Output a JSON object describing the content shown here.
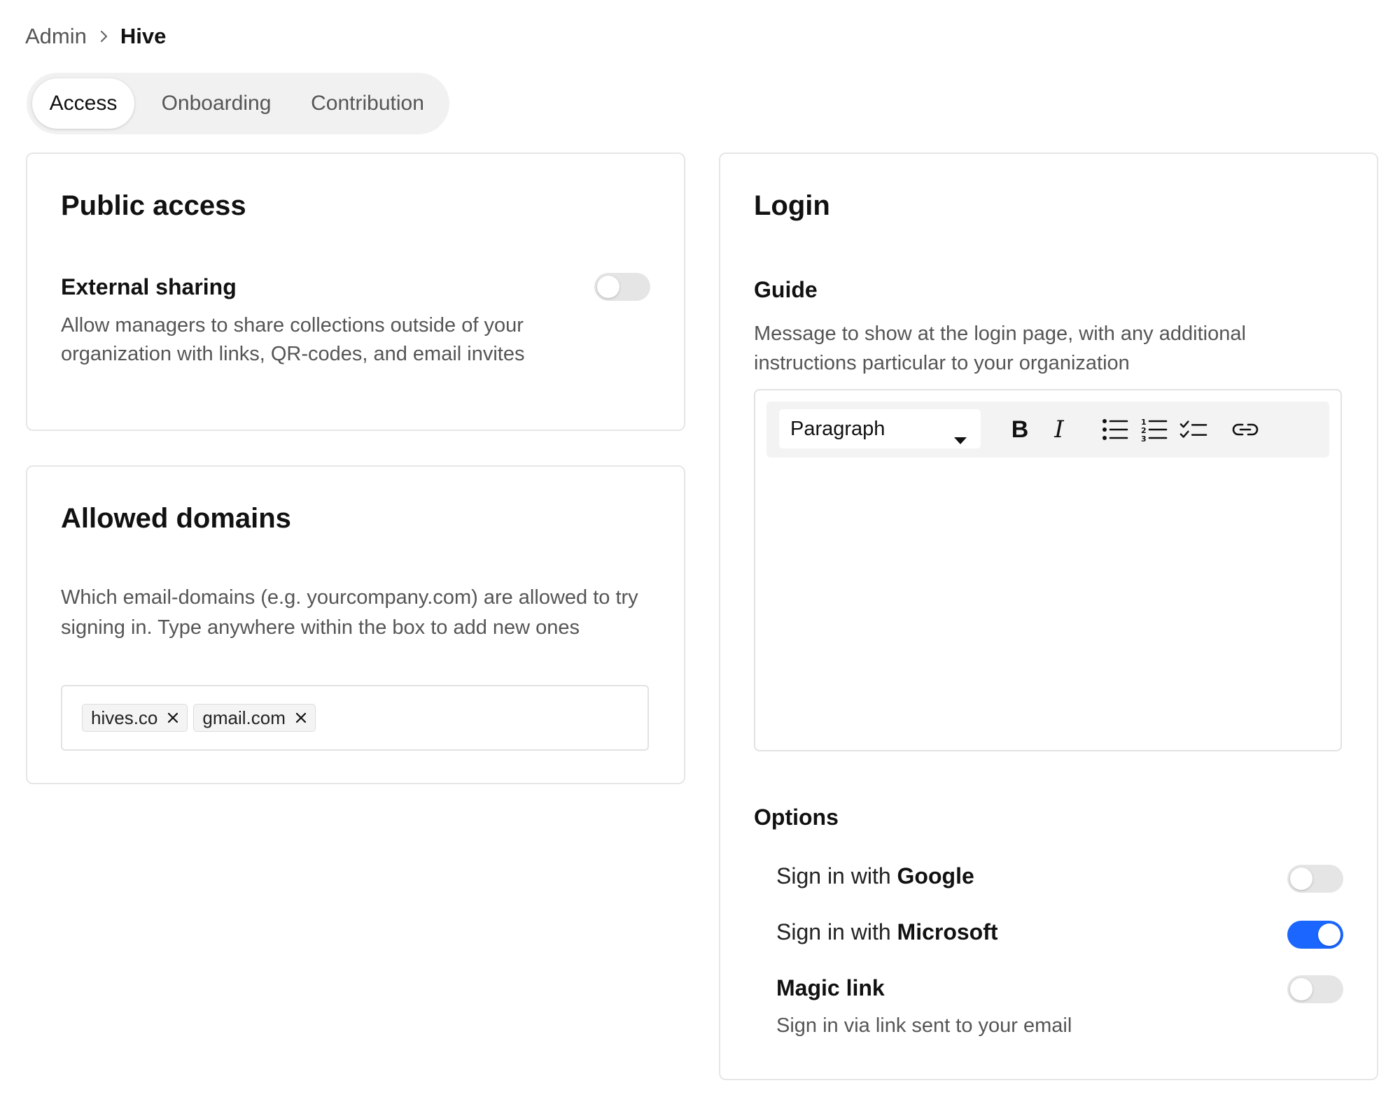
{
  "breadcrumb": {
    "parent": "Admin",
    "current": "Hive"
  },
  "tabs": [
    {
      "label": "Access",
      "active": true
    },
    {
      "label": "Onboarding",
      "active": false
    },
    {
      "label": "Contribution",
      "active": false
    }
  ],
  "public_access": {
    "title": "Public access",
    "external_sharing": {
      "title": "External sharing",
      "description": "Allow managers to share collections outside of your organization with links, QR-codes, and email invites",
      "enabled": false
    }
  },
  "allowed_domains": {
    "title": "Allowed domains",
    "description": "Which email-domains (e.g. yourcompany.com) are allowed to try signing in. Type anywhere within the box to add new ones",
    "domains": [
      "hives.co",
      "gmail.com"
    ]
  },
  "login": {
    "title": "Login",
    "guide": {
      "title": "Guide",
      "description": "Message to show at the login page, with any additional instructions particular to your organization",
      "editor": {
        "block_format": "Paragraph",
        "bold_label": "B",
        "italic_label": "I",
        "content": ""
      }
    },
    "options": {
      "title": "Options",
      "google": {
        "prefix": "Sign in with ",
        "provider": "Google",
        "enabled": false
      },
      "microsoft": {
        "prefix": "Sign in with ",
        "provider": "Microsoft",
        "enabled": true
      },
      "magic_link": {
        "title": "Magic link",
        "description": "Sign in via link sent to your email",
        "enabled": false
      }
    }
  },
  "colors": {
    "accent": "#1a66ff",
    "toggle_off": "#e5e5e5",
    "muted_text": "#555555",
    "border": "#e6e6e6"
  },
  "icons": {
    "breadcrumb_separator": "chevron-right-icon",
    "select_caret": "caret-down-icon",
    "bullet_list": "bullet-list-icon",
    "numbered_list": "numbered-list-icon",
    "checklist": "checklist-icon",
    "link": "link-icon",
    "tag_remove": "close-icon"
  }
}
